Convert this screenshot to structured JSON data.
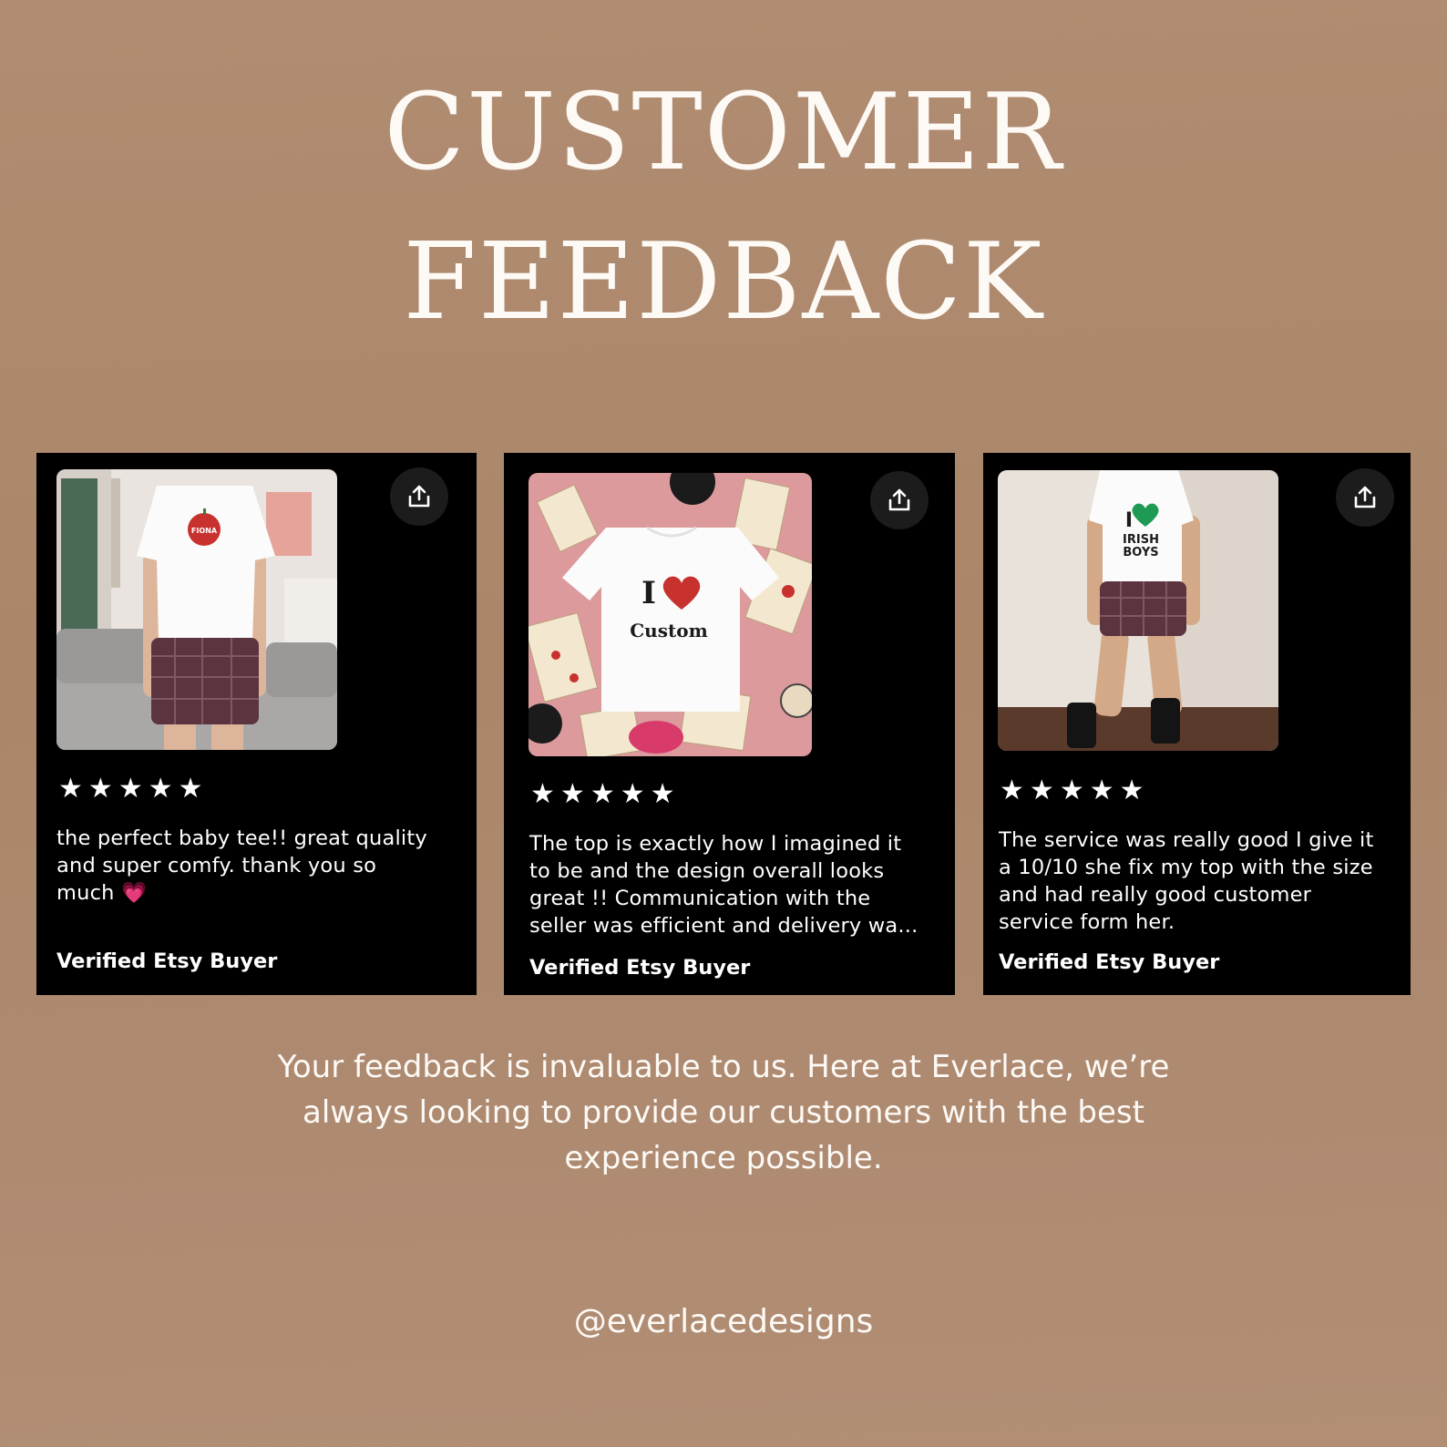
{
  "page": {
    "title_line1": "CUSTOMER",
    "title_line2": "FEEDBACK",
    "blurb_line1": "Your feedback is invaluable to us. Here at Everlace, we’re",
    "blurb_line2": "always looking to provide our customers with the best",
    "blurb_line3": "experience possible.",
    "handle": "@everlacedesigns"
  },
  "colors": {
    "background": "#ad8970",
    "card": "#000000",
    "text": "#ffffff",
    "heart_red": "#c8322e",
    "heart_green": "#1e9a55",
    "shorts_plaid": "#5b3440"
  },
  "reviews": [
    {
      "rating": 5,
      "stars": [
        "★",
        "★",
        "★",
        "★",
        "★"
      ],
      "text_lines": [
        "the perfect baby tee!! great quality",
        "and super comfy. thank you so",
        "much 💗"
      ],
      "buyer": "Verified Etsy Buyer",
      "photo": {
        "shirt_print": "FIONA",
        "icon": "apple-icon"
      }
    },
    {
      "rating": 5,
      "stars": [
        "★",
        "★",
        "★",
        "★",
        "★"
      ],
      "text_lines": [
        "The top is exactly how I imagined it",
        "to be and the design overall looks",
        "great !! Communication with the",
        "seller was efficient and delivery wa..."
      ],
      "buyer": "Verified Etsy Buyer",
      "photo": {
        "shirt_print_top": "I",
        "shirt_print_bottom": "Custom",
        "icon": "heart-icon"
      }
    },
    {
      "rating": 5,
      "stars": [
        "★",
        "★",
        "★",
        "★",
        "★"
      ],
      "text_lines": [
        "The service was really good I give it",
        "a 10/10 she fix my top with the size",
        "and had really good customer",
        "service form her."
      ],
      "buyer": "Verified Etsy Buyer",
      "photo": {
        "shirt_print_top": "I",
        "shirt_print_line2": "IRISH",
        "shirt_print_line3": "BOYS",
        "icon": "heart-icon"
      }
    }
  ]
}
